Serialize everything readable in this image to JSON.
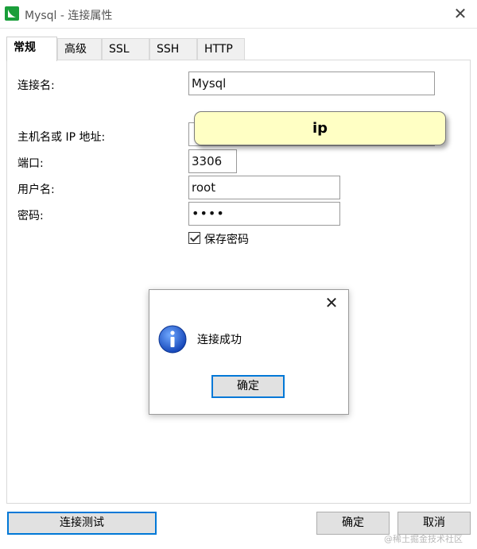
{
  "window": {
    "title": "Mysql - 连接属性",
    "close_glyph": "✕"
  },
  "tabs": [
    {
      "label": "常规",
      "active": true
    },
    {
      "label": "高级",
      "active": false
    },
    {
      "label": "SSL",
      "active": false
    },
    {
      "label": "SSH",
      "active": false
    },
    {
      "label": "HTTP",
      "active": false
    }
  ],
  "form": {
    "connection_name_label": "连接名:",
    "connection_name_value": "Mysql",
    "host_label": "主机名或 IP 地址:",
    "port_label": "端口:",
    "port_value": "3306",
    "username_label": "用户名:",
    "username_value": "root",
    "password_label": "密码:",
    "password_value": "••••",
    "save_password_label": "保存密码",
    "save_password_checked": true
  },
  "tooltip": {
    "text": "ip"
  },
  "dialog": {
    "close_glyph": "✕",
    "message": "连接成功",
    "ok_label": "确定"
  },
  "footer": {
    "test_connection_label": "连接测试",
    "ok_label": "确定",
    "cancel_label": "取消"
  },
  "watermark": "@稀土掘金技术社区",
  "colors": {
    "accent": "#0078d7",
    "tooltip_bg": "#ffffc4",
    "app_icon": "#1a9e3a"
  }
}
